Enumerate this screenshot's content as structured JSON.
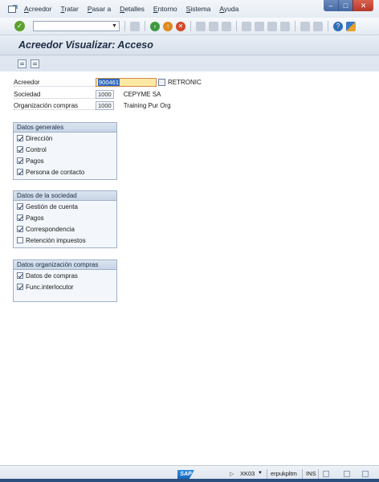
{
  "menu": {
    "items": [
      "Acreedor",
      "Tratar",
      "Pasar a",
      "Detalles",
      "Entorno",
      "Sistema",
      "Ayuda"
    ]
  },
  "toolbar": {
    "command_field_value": ""
  },
  "title": "Acreedor Visualizar: Acceso",
  "fields": {
    "acreedor": {
      "label": "Acreedor",
      "value": "900461",
      "description": "RETRONIC"
    },
    "sociedad": {
      "label": "Sociedad",
      "value": "1000",
      "description": "CEPYME SA"
    },
    "org_compras": {
      "label": "Organización compras",
      "value": "1000",
      "description": "Training Pur Org"
    }
  },
  "groups": {
    "datos_generales": {
      "title": "Datos generales",
      "items": [
        {
          "label": "Dirección",
          "checked": true
        },
        {
          "label": "Control",
          "checked": true
        },
        {
          "label": "Pagos",
          "checked": true
        },
        {
          "label": "Persona de contacto",
          "checked": true
        }
      ]
    },
    "datos_sociedad": {
      "title": "Datos de la sociedad",
      "items": [
        {
          "label": "Gestión de cuenta",
          "checked": true
        },
        {
          "label": "Pagos",
          "checked": true
        },
        {
          "label": "Correspondencia",
          "checked": true
        },
        {
          "label": "Retención impuestos",
          "checked": false
        }
      ]
    },
    "datos_org_compras": {
      "title": "Datos organización compras",
      "items": [
        {
          "label": "Datos de compras",
          "checked": true
        },
        {
          "label": "Func.interlocutor",
          "checked": true
        }
      ]
    }
  },
  "status": {
    "logo": "SAP",
    "transaction": "XK03",
    "server": "erpukpltm",
    "mode": "INS"
  }
}
